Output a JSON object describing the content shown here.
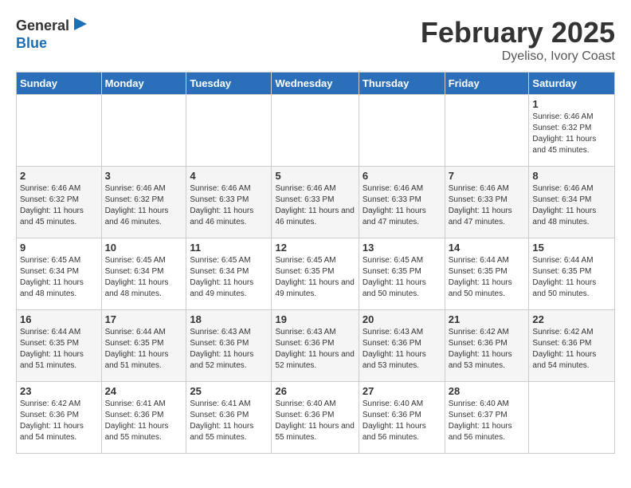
{
  "header": {
    "logo_general": "General",
    "logo_blue": "Blue",
    "month_year": "February 2025",
    "location": "Dyeliso, Ivory Coast"
  },
  "days_of_week": [
    "Sunday",
    "Monday",
    "Tuesday",
    "Wednesday",
    "Thursday",
    "Friday",
    "Saturday"
  ],
  "weeks": [
    [
      {
        "num": "",
        "info": ""
      },
      {
        "num": "",
        "info": ""
      },
      {
        "num": "",
        "info": ""
      },
      {
        "num": "",
        "info": ""
      },
      {
        "num": "",
        "info": ""
      },
      {
        "num": "",
        "info": ""
      },
      {
        "num": "1",
        "info": "Sunrise: 6:46 AM\nSunset: 6:32 PM\nDaylight: 11 hours and 45 minutes."
      }
    ],
    [
      {
        "num": "2",
        "info": "Sunrise: 6:46 AM\nSunset: 6:32 PM\nDaylight: 11 hours and 45 minutes."
      },
      {
        "num": "3",
        "info": "Sunrise: 6:46 AM\nSunset: 6:32 PM\nDaylight: 11 hours and 46 minutes."
      },
      {
        "num": "4",
        "info": "Sunrise: 6:46 AM\nSunset: 6:33 PM\nDaylight: 11 hours and 46 minutes."
      },
      {
        "num": "5",
        "info": "Sunrise: 6:46 AM\nSunset: 6:33 PM\nDaylight: 11 hours and 46 minutes."
      },
      {
        "num": "6",
        "info": "Sunrise: 6:46 AM\nSunset: 6:33 PM\nDaylight: 11 hours and 47 minutes."
      },
      {
        "num": "7",
        "info": "Sunrise: 6:46 AM\nSunset: 6:33 PM\nDaylight: 11 hours and 47 minutes."
      },
      {
        "num": "8",
        "info": "Sunrise: 6:46 AM\nSunset: 6:34 PM\nDaylight: 11 hours and 48 minutes."
      }
    ],
    [
      {
        "num": "9",
        "info": "Sunrise: 6:45 AM\nSunset: 6:34 PM\nDaylight: 11 hours and 48 minutes."
      },
      {
        "num": "10",
        "info": "Sunrise: 6:45 AM\nSunset: 6:34 PM\nDaylight: 11 hours and 48 minutes."
      },
      {
        "num": "11",
        "info": "Sunrise: 6:45 AM\nSunset: 6:34 PM\nDaylight: 11 hours and 49 minutes."
      },
      {
        "num": "12",
        "info": "Sunrise: 6:45 AM\nSunset: 6:35 PM\nDaylight: 11 hours and 49 minutes."
      },
      {
        "num": "13",
        "info": "Sunrise: 6:45 AM\nSunset: 6:35 PM\nDaylight: 11 hours and 50 minutes."
      },
      {
        "num": "14",
        "info": "Sunrise: 6:44 AM\nSunset: 6:35 PM\nDaylight: 11 hours and 50 minutes."
      },
      {
        "num": "15",
        "info": "Sunrise: 6:44 AM\nSunset: 6:35 PM\nDaylight: 11 hours and 50 minutes."
      }
    ],
    [
      {
        "num": "16",
        "info": "Sunrise: 6:44 AM\nSunset: 6:35 PM\nDaylight: 11 hours and 51 minutes."
      },
      {
        "num": "17",
        "info": "Sunrise: 6:44 AM\nSunset: 6:35 PM\nDaylight: 11 hours and 51 minutes."
      },
      {
        "num": "18",
        "info": "Sunrise: 6:43 AM\nSunset: 6:36 PM\nDaylight: 11 hours and 52 minutes."
      },
      {
        "num": "19",
        "info": "Sunrise: 6:43 AM\nSunset: 6:36 PM\nDaylight: 11 hours and 52 minutes."
      },
      {
        "num": "20",
        "info": "Sunrise: 6:43 AM\nSunset: 6:36 PM\nDaylight: 11 hours and 53 minutes."
      },
      {
        "num": "21",
        "info": "Sunrise: 6:42 AM\nSunset: 6:36 PM\nDaylight: 11 hours and 53 minutes."
      },
      {
        "num": "22",
        "info": "Sunrise: 6:42 AM\nSunset: 6:36 PM\nDaylight: 11 hours and 54 minutes."
      }
    ],
    [
      {
        "num": "23",
        "info": "Sunrise: 6:42 AM\nSunset: 6:36 PM\nDaylight: 11 hours and 54 minutes."
      },
      {
        "num": "24",
        "info": "Sunrise: 6:41 AM\nSunset: 6:36 PM\nDaylight: 11 hours and 55 minutes."
      },
      {
        "num": "25",
        "info": "Sunrise: 6:41 AM\nSunset: 6:36 PM\nDaylight: 11 hours and 55 minutes."
      },
      {
        "num": "26",
        "info": "Sunrise: 6:40 AM\nSunset: 6:36 PM\nDaylight: 11 hours and 55 minutes."
      },
      {
        "num": "27",
        "info": "Sunrise: 6:40 AM\nSunset: 6:36 PM\nDaylight: 11 hours and 56 minutes."
      },
      {
        "num": "28",
        "info": "Sunrise: 6:40 AM\nSunset: 6:37 PM\nDaylight: 11 hours and 56 minutes."
      },
      {
        "num": "",
        "info": ""
      }
    ]
  ]
}
